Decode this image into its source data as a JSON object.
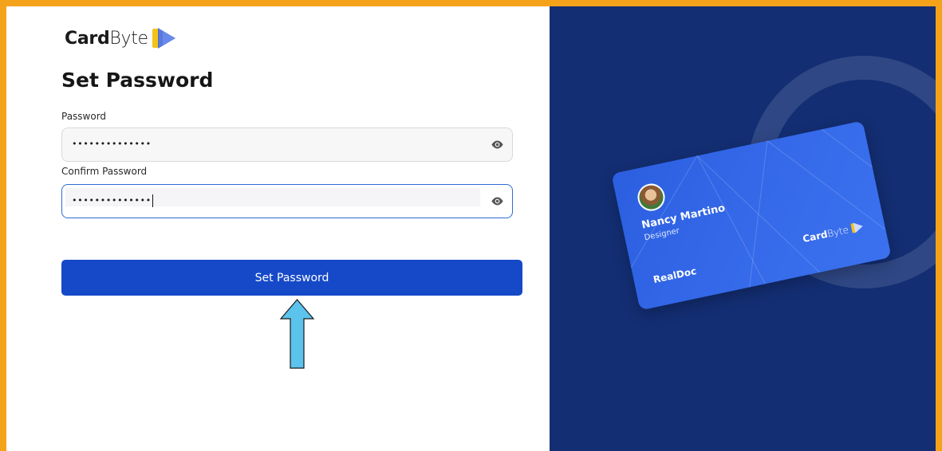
{
  "brand": {
    "name_bold": "Card",
    "name_light": "Byte"
  },
  "form": {
    "title": "Set Password",
    "password": {
      "label": "Password",
      "value": "••••••••••••••"
    },
    "confirm_password": {
      "label": "Confirm Password",
      "value": "••••••••••••••"
    },
    "submit_label": "Set Password"
  },
  "card_preview": {
    "name": "Nancy Martino",
    "role": "Designer",
    "company": "RealDoc",
    "logo_bold": "Card",
    "logo_light": "Byte"
  },
  "colors": {
    "frame_border": "#f5a21b",
    "primary": "#1549c8",
    "panel_bg": "#132e73",
    "card": "#3468e8",
    "annotation_arrow": "#5bc3ec"
  }
}
